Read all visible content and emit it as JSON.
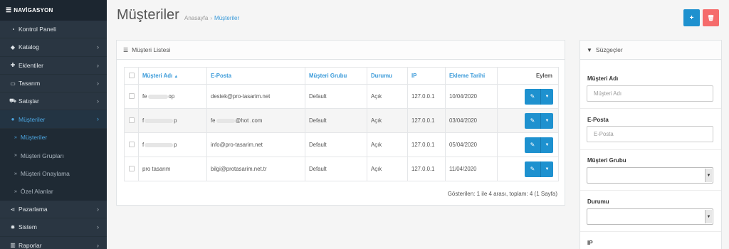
{
  "sidebar": {
    "brand": "NAVİGASYON",
    "items": [
      {
        "label": "Kontrol Paneli",
        "icon": "dashboard-icon",
        "chevron": false
      },
      {
        "label": "Katalog",
        "icon": "tag-icon",
        "chevron": true
      },
      {
        "label": "Eklentiler",
        "icon": "puzzle-icon",
        "chevron": true
      },
      {
        "label": "Tasarım",
        "icon": "monitor-icon",
        "chevron": true
      },
      {
        "label": "Satışlar",
        "icon": "cart-icon",
        "chevron": true
      },
      {
        "label": "Müşteriler",
        "icon": "user-icon",
        "chevron": true,
        "active": true
      }
    ],
    "subitems": [
      {
        "label": "Müşteriler",
        "active": true
      },
      {
        "label": "Müşteri Grupları"
      },
      {
        "label": "Müşteri Onaylama"
      },
      {
        "label": "Özel Alanlar"
      }
    ],
    "items_after": [
      {
        "label": "Pazarlama",
        "icon": "share-icon",
        "chevron": true
      },
      {
        "label": "Sistem",
        "icon": "gear-icon",
        "chevron": true
      },
      {
        "label": "Raporlar",
        "icon": "bar-chart-icon",
        "chevron": true
      }
    ]
  },
  "header": {
    "title": "Müşteriler",
    "breadcrumb": [
      "Anasayfa",
      "Müşteriler"
    ],
    "add_button": "+",
    "delete_button": "🗑"
  },
  "list": {
    "title": "Müşteri Listesi",
    "columns": [
      "Müşteri Adı",
      "E-Posta",
      "Müşteri Grubu",
      "Durumu",
      "IP",
      "Ekleme Tarihi",
      "Eylem"
    ],
    "sort_indicator": "▲",
    "rows": [
      {
        "name": "fe",
        "name_tail": "op",
        "email": "destek@pro-tasarim.net",
        "email_tail": "",
        "group": "Default",
        "status": "Açık",
        "ip": "127.0.0.1",
        "date": "10/04/2020"
      },
      {
        "name": "f",
        "name_tail": "p",
        "email": "fe",
        "email_tail": "@hot .com",
        "group": "Default",
        "status": "Açık",
        "ip": "127.0.0.1",
        "date": "03/04/2020"
      },
      {
        "name": "f",
        "name_tail": "p",
        "email": "info@pro-tasarim.net",
        "email_tail": "",
        "group": "Default",
        "status": "Açık",
        "ip": "127.0.0.1",
        "date": "05/04/2020"
      },
      {
        "name": "pro tasarım",
        "name_tail": "",
        "email": "bilgi@protasarim.net.tr",
        "email_tail": "",
        "group": "Default",
        "status": "Açık",
        "ip": "127.0.0.1",
        "date": "11/04/2020"
      }
    ],
    "pagination": "Gösterilen: 1 ile 4 arası, toplam: 4 (1 Sayfa)"
  },
  "filters": {
    "title": "Süzgeçler",
    "name_label": "Müşteri Adı",
    "name_placeholder": "Müşteri Adı",
    "email_label": "E-Posta",
    "email_placeholder": "E-Posta",
    "group_label": "Müşteri Grubu",
    "status_label": "Durumu",
    "ip_label": "IP"
  },
  "colors": {
    "sidebar": "#2a3642",
    "accent": "#1e91cf",
    "danger": "#f56b6b",
    "link": "#3a9ad9"
  }
}
